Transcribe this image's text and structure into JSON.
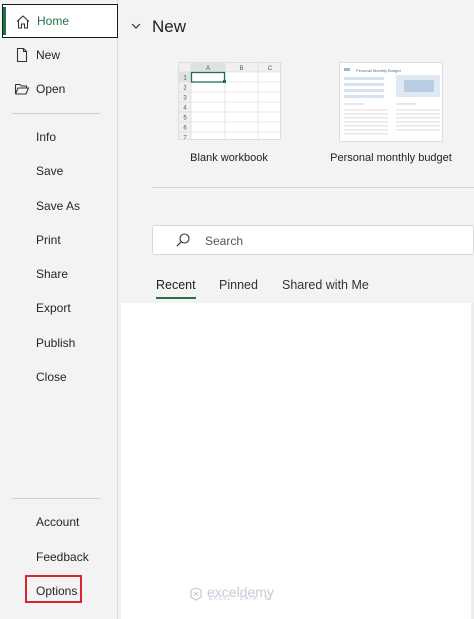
{
  "sidebar": {
    "items_top": [
      {
        "label": "Home",
        "icon": "home-icon",
        "active": true
      },
      {
        "label": "New",
        "icon": "new-document-icon"
      },
      {
        "label": "Open",
        "icon": "open-folder-icon"
      }
    ],
    "items_mid": [
      {
        "label": "Info"
      },
      {
        "label": "Save"
      },
      {
        "label": "Save As"
      },
      {
        "label": "Print"
      },
      {
        "label": "Share"
      },
      {
        "label": "Export"
      },
      {
        "label": "Publish"
      },
      {
        "label": "Close"
      }
    ],
    "items_bottom": [
      {
        "label": "Account"
      },
      {
        "label": "Feedback"
      },
      {
        "label": "Options",
        "highlighted": true
      }
    ],
    "accent_color": "#217346",
    "highlight_color": "#d9232e"
  },
  "main": {
    "section_title": "New",
    "templates": [
      {
        "label": "Blank workbook"
      },
      {
        "label": "Personal monthly budget",
        "thumb_title": "Personal Monthly Budget"
      }
    ],
    "blank_grid": {
      "columns": [
        "A",
        "B",
        "C"
      ],
      "rows": [
        "1",
        "2",
        "3",
        "4",
        "5",
        "6",
        "7"
      ]
    },
    "search": {
      "placeholder": "Search"
    },
    "tabs": [
      {
        "label": "Recent",
        "active": true
      },
      {
        "label": "Pinned"
      },
      {
        "label": "Shared with Me"
      }
    ]
  },
  "watermark": {
    "name": "exceldemy",
    "tagline": "EXCEL · DATA · BI"
  }
}
